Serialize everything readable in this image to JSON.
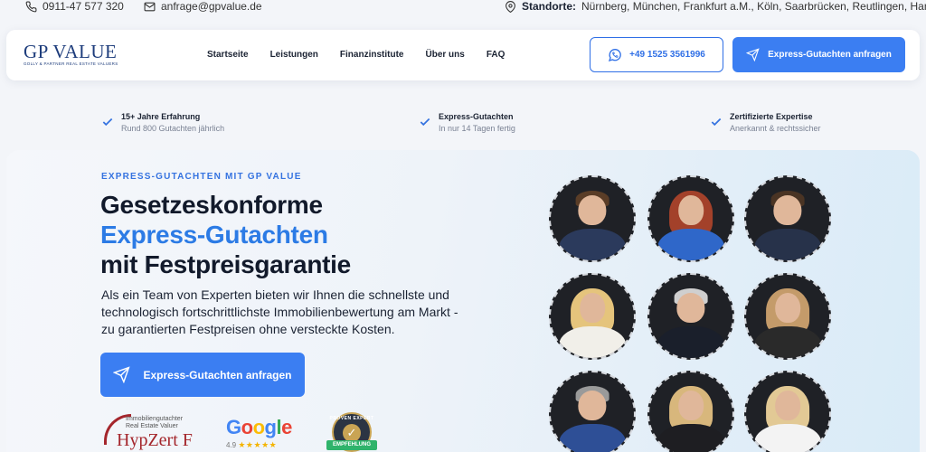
{
  "topbar": {
    "phone": "0911-47 577 320",
    "email": "anfrage@gpvalue.de",
    "locations_label": "Standorte:",
    "locations": "Nürnberg, München, Frankfurt a.M., Köln, Saarbrücken, Reutlingen, Hamburg"
  },
  "header": {
    "logo_name": "GP VALUE",
    "logo_tagline": "GOLLY & PARTNER REAL ESTATE VALUERS",
    "nav": [
      "Startseite",
      "Leistungen",
      "Finanzinstitute",
      "Über uns",
      "FAQ"
    ],
    "whatsapp_number": "+49 1525 3561996",
    "cta_label": "Express-Gutachten anfragen"
  },
  "features": [
    {
      "title": "15+ Jahre Erfahrung",
      "subtitle": "Rund 800 Gutachten jährlich"
    },
    {
      "title": "Express-Gutachten",
      "subtitle": "In nur 14 Tagen fertig"
    },
    {
      "title": "Zertifizierte Expertise",
      "subtitle": "Anerkannt & rechtssicher"
    }
  ],
  "hero": {
    "eyebrow": "EXPRESS-GUTACHTEN MIT GP VALUE",
    "headline_line1": "Gesetzeskonforme",
    "headline_line2": "Express-Gutachten",
    "headline_line3": "mit Festpreisgarantie",
    "lead": "Als ein Team von Experten bieten wir Ihnen die schnellste und technologisch fortschrittlichste Immobilienbewertung am Markt - zu garantierten Festpreisen ohne versteckte Kosten.",
    "cta_label": "Express-Gutachten anfragen"
  },
  "badges": {
    "hypzert_small_1": "Immobiliengutachter",
    "hypzert_small_2": "Real Estate Valuer",
    "hypzert_big": "HypZert F",
    "google_word": "Google",
    "google_rating": "4.9",
    "google_stars": "★★★★★",
    "pe_top": "PROVEN EXPERT",
    "pe_ribbon": "EMPFEHLUNG"
  },
  "colors": {
    "accent": "#3b7ef2",
    "headline_blue": "#2c7be5",
    "logo_navy": "#1e3d7c",
    "check_blue": "#3573e0"
  },
  "team_icons": [
    "team-member-photo"
  ]
}
